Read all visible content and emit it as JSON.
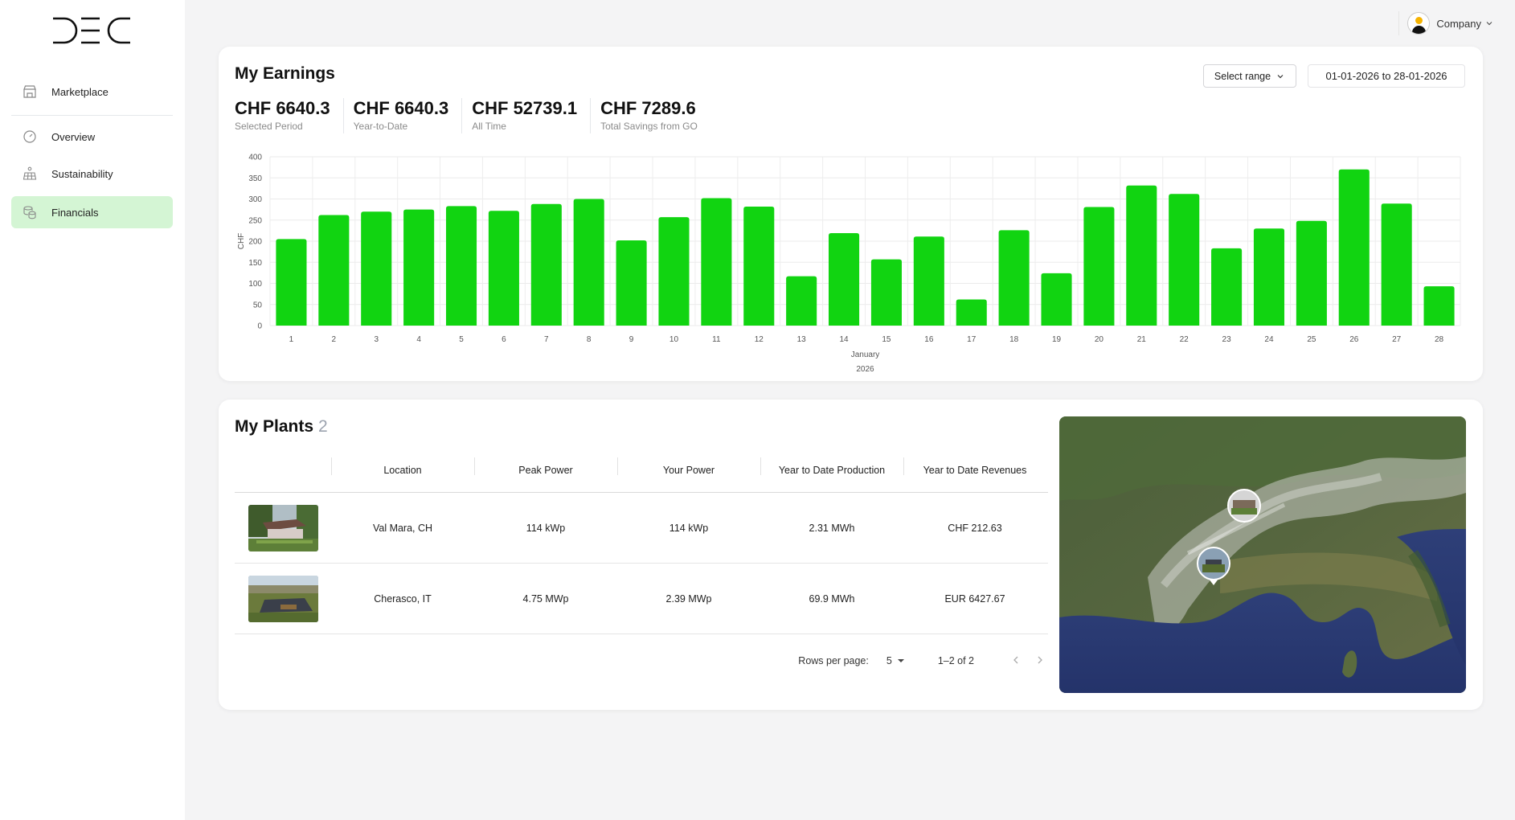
{
  "sidebar": {
    "items": [
      {
        "label": "Marketplace",
        "icon": "store-icon"
      },
      {
        "label": "Overview",
        "icon": "gauge-icon"
      },
      {
        "label": "Sustainability",
        "icon": "solar-panel-icon"
      },
      {
        "label": "Financials",
        "icon": "coins-icon",
        "active": true
      }
    ]
  },
  "user": {
    "name": "Company"
  },
  "earnings": {
    "title": "My Earnings",
    "select_range": "Select range",
    "date_range": "01-01-2026 to 28-01-2026",
    "stats": [
      {
        "value": "CHF 6640.3",
        "label": "Selected Period"
      },
      {
        "value": "CHF 6640.3",
        "label": "Year-to-Date"
      },
      {
        "value": "CHF 52739.1",
        "label": "All Time"
      },
      {
        "value": "CHF 7289.6",
        "label": "Total Savings from GO"
      }
    ]
  },
  "chart_data": {
    "type": "bar",
    "categories": [
      "1",
      "2",
      "3",
      "4",
      "5",
      "6",
      "7",
      "8",
      "9",
      "10",
      "11",
      "12",
      "13",
      "14",
      "15",
      "16",
      "17",
      "18",
      "19",
      "20",
      "21",
      "22",
      "23",
      "24",
      "25",
      "26",
      "27",
      "28"
    ],
    "values": [
      205,
      262,
      270,
      275,
      283,
      272,
      288,
      300,
      202,
      257,
      302,
      282,
      117,
      219,
      157,
      211,
      62,
      226,
      124,
      281,
      332,
      312,
      183,
      230,
      248,
      370,
      289,
      93
    ],
    "ylabel": "CHF",
    "xlabel": "January",
    "xlabel2": "2026",
    "ylim": [
      0,
      400
    ],
    "yticks": [
      0,
      50,
      100,
      150,
      200,
      250,
      300,
      350,
      400
    ],
    "grid": true,
    "bar_color": "#11d411"
  },
  "plants": {
    "title": "My Plants",
    "count": "2",
    "columns": [
      "Location",
      "Peak Power",
      "Your Power",
      "Year to Date Production",
      "Year to Date Revenues"
    ],
    "rows": [
      {
        "location": "Val Mara, CH",
        "peak": "114 kWp",
        "your": "114 kWp",
        "production": "2.31 MWh",
        "revenue": "CHF 212.63"
      },
      {
        "location": "Cherasco, IT",
        "peak": "4.75 MWp",
        "your": "2.39 MWp",
        "production": "69.9 MWh",
        "revenue": "EUR 6427.67"
      }
    ],
    "rows_per_page_label": "Rows per page:",
    "rows_per_page": "5",
    "page_range": "1–2 of 2"
  }
}
